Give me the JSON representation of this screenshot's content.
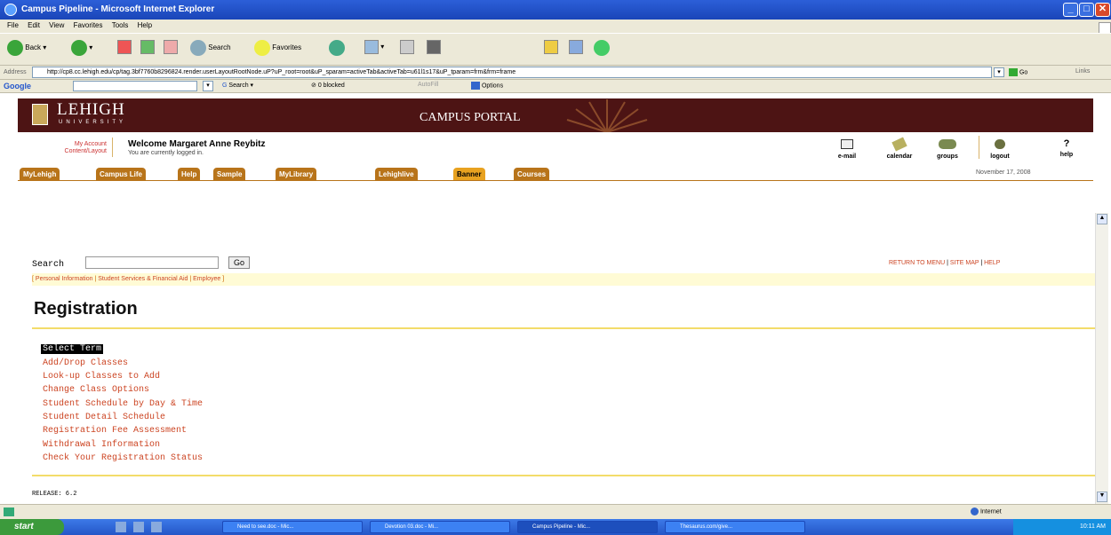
{
  "window": {
    "title": "Campus Pipeline - Microsoft Internet Explorer",
    "min": "_",
    "max": "□",
    "close": "✕"
  },
  "menu": [
    "File",
    "Edit",
    "View",
    "Favorites",
    "Tools",
    "Help"
  ],
  "toolbar": {
    "back": "Back",
    "search": "Search",
    "favorites": "Favorites"
  },
  "address": {
    "label": "Address",
    "url": "http://cp8.cc.lehigh.edu/cp/tag.3bf7760b8296824.render.userLayoutRootNode.uP?uP_root=root&uP_sparam=activeTab&activeTab=u61l1s17&uP_tparam=frm&frm=frame",
    "go": "Go",
    "links": "Links"
  },
  "googlebar": {
    "label": "Google",
    "search": "Search",
    "blocked": "0 blocked",
    "autofill": "AutoFill",
    "options": "Options"
  },
  "portal": {
    "logo_main": "LEHIGH",
    "logo_sub": "UNIVERSITY",
    "campus": "CAMPUS PORTAL"
  },
  "welcome": {
    "my_account": "My Account",
    "content_layout": "Content/Layout",
    "title": "Welcome Margaret Anne Reybitz",
    "sub": "You are currently logged in."
  },
  "utility": [
    "e-mail",
    "calendar",
    "groups",
    "logout",
    "help"
  ],
  "tabs": [
    "MyLehigh",
    "Campus Life",
    "Help",
    "Sample",
    "MyLibrary",
    "Lehighlive",
    "Banner",
    "Courses"
  ],
  "date": "November 17, 2008",
  "banner": {
    "search_label": "Search",
    "go": "Go",
    "return_menu": "RETURN TO MENU",
    "site_map": "SITE MAP",
    "help": "HELP",
    "crumbs": [
      "Personal Information",
      "Student Services & Financial Aid",
      "Employee"
    ],
    "title": "Registration",
    "items": [
      "Select Term",
      "Add/Drop Classes",
      "Look-up Classes to Add",
      "Change Class Options",
      "Student Schedule by Day & Time",
      "Student Detail Schedule",
      "Registration Fee Assessment",
      "Withdrawal Information",
      "Check Your Registration Status"
    ],
    "release": "RELEASE: 6.2"
  },
  "status": {
    "zone": "Internet"
  },
  "taskbar": {
    "start": "start",
    "tasks": [
      "Need to see.doc - Mic...",
      "Devotion 03.doc - Mi...",
      "Campus Pipeline - Mic...",
      "Thesaurus.com/give..."
    ],
    "clock": "10:11 AM"
  }
}
